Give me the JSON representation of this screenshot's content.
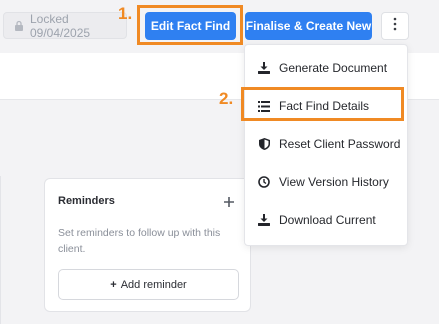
{
  "topbar": {
    "locked_label": "Locked 09/04/2025",
    "edit_label": "Edit Fact Find",
    "finalise_label": "Finalise & Create New"
  },
  "annotations": {
    "step1": "1.",
    "step2": "2."
  },
  "menu": {
    "items": [
      {
        "label": "Generate Document",
        "icon": "download-icon"
      },
      {
        "label": "Fact Find Details",
        "icon": "list-icon"
      },
      {
        "label": "Reset Client Password",
        "icon": "shield-icon"
      },
      {
        "label": "View Version History",
        "icon": "history-clock-icon"
      },
      {
        "label": "Download Current",
        "icon": "download-icon"
      }
    ]
  },
  "reminders": {
    "title": "Reminders",
    "empty_text": "Set reminders to follow up with this client.",
    "add_button_label": "Add reminder"
  },
  "colors": {
    "primary": "#2f80f1",
    "highlight": "#f08a24"
  }
}
